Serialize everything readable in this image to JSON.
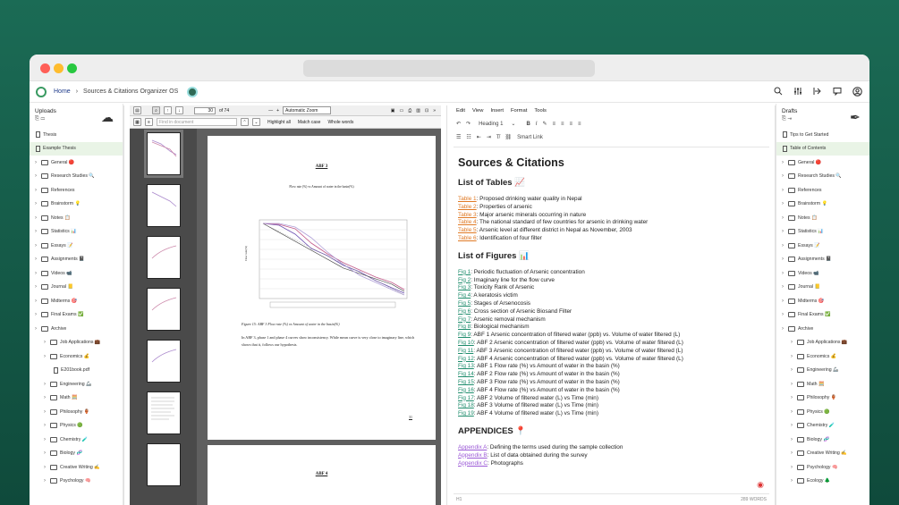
{
  "breadcrumb": {
    "home": "Home",
    "app": "Sources & Citations Organizer OS"
  },
  "icons": {
    "top": [
      "search-icon",
      "sliders-icon",
      "share-icon",
      "chat-icon",
      "user-icon"
    ]
  },
  "left": {
    "title": "Uploads",
    "items": [
      {
        "label": "Thesis",
        "type": "file",
        "indent": 0,
        "sel": false
      },
      {
        "label": "Example Thesis",
        "type": "file",
        "indent": 0,
        "sel": true
      },
      {
        "label": "General 🔴",
        "type": "folder",
        "indent": 0,
        "sel": false
      },
      {
        "label": "Research Studies 🔍",
        "type": "folder",
        "indent": 0,
        "sel": false
      },
      {
        "label": "References",
        "type": "folder",
        "indent": 0,
        "sel": false
      },
      {
        "label": "Brainstorm 💡",
        "type": "folder",
        "indent": 0,
        "sel": false
      },
      {
        "label": "Notes 📋",
        "type": "folder",
        "indent": 0,
        "sel": false
      },
      {
        "label": "Statistics 📊",
        "type": "folder",
        "indent": 0,
        "sel": false
      },
      {
        "label": "Essays 📝",
        "type": "folder",
        "indent": 0,
        "sel": false
      },
      {
        "label": "Assignments 📓",
        "type": "folder",
        "indent": 0,
        "sel": false
      },
      {
        "label": "Videos 📹",
        "type": "folder",
        "indent": 0,
        "sel": false
      },
      {
        "label": "Journal 📒",
        "type": "folder",
        "indent": 0,
        "sel": false
      },
      {
        "label": "Midterms 🎯",
        "type": "folder",
        "indent": 0,
        "sel": false
      },
      {
        "label": "Final Exams ✅",
        "type": "folder",
        "indent": 0,
        "sel": false
      },
      {
        "label": "Archive",
        "type": "folder",
        "indent": 0,
        "sel": false
      },
      {
        "label": "Job Applications 💼",
        "type": "folder",
        "indent": 1,
        "sel": false
      },
      {
        "label": "Economics 💰",
        "type": "folder",
        "indent": 1,
        "sel": false
      },
      {
        "label": "E201book.pdf",
        "type": "file",
        "indent": 2,
        "sel": false
      },
      {
        "label": "Engineering 🦾",
        "type": "folder",
        "indent": 1,
        "sel": false
      },
      {
        "label": "Math 🧮",
        "type": "folder",
        "indent": 1,
        "sel": false
      },
      {
        "label": "Philosophy 🏺",
        "type": "folder",
        "indent": 1,
        "sel": false
      },
      {
        "label": "Physics 🟢",
        "type": "folder",
        "indent": 1,
        "sel": false
      },
      {
        "label": "Chemistry 🧪",
        "type": "folder",
        "indent": 1,
        "sel": false
      },
      {
        "label": "Biology 🧬",
        "type": "folder",
        "indent": 1,
        "sel": false
      },
      {
        "label": "Creative Writing ✍️",
        "type": "folder",
        "indent": 1,
        "sel": false
      },
      {
        "label": "Psychology 🧠",
        "type": "folder",
        "indent": 1,
        "sel": false
      }
    ]
  },
  "right": {
    "title": "Drafts",
    "items": [
      {
        "label": "Tips to Get Started",
        "type": "file",
        "indent": 0,
        "sel": false
      },
      {
        "label": "Table of Contents",
        "type": "file",
        "indent": 0,
        "sel": true
      },
      {
        "label": "General 🔴",
        "type": "folder",
        "indent": 0,
        "sel": false
      },
      {
        "label": "Research Studies 🔍",
        "type": "folder",
        "indent": 0,
        "sel": false
      },
      {
        "label": "References",
        "type": "folder",
        "indent": 0,
        "sel": false
      },
      {
        "label": "Brainstorm 💡",
        "type": "folder",
        "indent": 0,
        "sel": false
      },
      {
        "label": "Notes 📋",
        "type": "folder",
        "indent": 0,
        "sel": false
      },
      {
        "label": "Statistics 📊",
        "type": "folder",
        "indent": 0,
        "sel": false
      },
      {
        "label": "Essays 📝",
        "type": "folder",
        "indent": 0,
        "sel": false
      },
      {
        "label": "Assignments 📓",
        "type": "folder",
        "indent": 0,
        "sel": false
      },
      {
        "label": "Videos 📹",
        "type": "folder",
        "indent": 0,
        "sel": false
      },
      {
        "label": "Journal 📒",
        "type": "folder",
        "indent": 0,
        "sel": false
      },
      {
        "label": "Midterms 🎯",
        "type": "folder",
        "indent": 0,
        "sel": false
      },
      {
        "label": "Final Exams ✅",
        "type": "folder",
        "indent": 0,
        "sel": false
      },
      {
        "label": "Archive",
        "type": "folder",
        "indent": 0,
        "sel": false
      },
      {
        "label": "Job Applications 💼",
        "type": "folder",
        "indent": 1,
        "sel": false
      },
      {
        "label": "Economics 💰",
        "type": "folder",
        "indent": 1,
        "sel": false
      },
      {
        "label": "Engineering 🦾",
        "type": "folder",
        "indent": 1,
        "sel": false
      },
      {
        "label": "Math 🧮",
        "type": "folder",
        "indent": 1,
        "sel": false
      },
      {
        "label": "Philosophy 🏺",
        "type": "folder",
        "indent": 1,
        "sel": false
      },
      {
        "label": "Physics 🟢",
        "type": "folder",
        "indent": 1,
        "sel": false
      },
      {
        "label": "Chemistry 🧪",
        "type": "folder",
        "indent": 1,
        "sel": false
      },
      {
        "label": "Biology 🧬",
        "type": "folder",
        "indent": 1,
        "sel": false
      },
      {
        "label": "Creative Writing ✍️",
        "type": "folder",
        "indent": 1,
        "sel": false
      },
      {
        "label": "Psychology 🧠",
        "type": "folder",
        "indent": 1,
        "sel": false
      },
      {
        "label": "Ecology 🌲",
        "type": "folder",
        "indent": 1,
        "sel": false
      }
    ]
  },
  "pdf": {
    "page_num": "30",
    "page_total": "of 74",
    "zoom": "Automatic Zoom",
    "find_placeholder": "Find in document",
    "highlight_all": "Highlight all",
    "match_case": "Match case",
    "whole_words": "Whole words",
    "page_heading": "ABF 3",
    "chart_title": "Flow rate (%) vs Amount of water in the basin(%)",
    "caption": "Figure 15: ABF 3 Flow rate (%) vs Amount of water in the basin(%)",
    "body": "In ABF 3, phase 1 and phase 4 curves show inconsistency. While mean curve is very close to imaginary line, which shows that it, follows our hypothesis.",
    "page_no": "31",
    "next_heading": "ABF 4"
  },
  "editor": {
    "menu": [
      "Edit",
      "View",
      "Insert",
      "Format",
      "Tools"
    ],
    "heading_select": "Heading 1",
    "smart_link": "Smart Link",
    "title": "Sources & Citations",
    "tables_h": "List of Tables 📈",
    "tables": [
      {
        "link": "Table 1",
        "text": ": Proposed drinking water quality in Nepal"
      },
      {
        "link": "Table 2",
        "text": ": Properties of arsenic"
      },
      {
        "link": "Table 3",
        "text": ": Major arsenic minerals occurring in nature"
      },
      {
        "link": "Table 4",
        "text": ": The national standard of few countries for arsenic in drinking water"
      },
      {
        "link": "Table 5",
        "text": ": Arsenic level at different district in Nepal as November, 2003"
      },
      {
        "link": "Table 6",
        "text": ": Identification of four filter"
      }
    ],
    "figs_h": "List of Figures 📊",
    "figs": [
      {
        "link": "Fig 1",
        "text": ": Periodic fluctuation of Arsenic concentration"
      },
      {
        "link": "Fig 2",
        "text": ": Imaginary line for the flow curve"
      },
      {
        "link": "Fig 3",
        "text": ": Toxicity Rank of Arsenic"
      },
      {
        "link": "Fig 4",
        "text": ": A keratosis victim"
      },
      {
        "link": "Fig 5",
        "text": ": Stages of Arsenocosis"
      },
      {
        "link": "Fig 6",
        "text": ": Cross section of Arsenic Biosand Filter"
      },
      {
        "link": "Fig 7",
        "text": ": Arsenic removal mechanism"
      },
      {
        "link": "Fig 8",
        "text": ": Biological mechanism"
      },
      {
        "link": "Fig 9",
        "text": ": ABF 1 Arsenic concentration of filtered water (ppb) vs. Volume of water filtered (L)"
      },
      {
        "link": "Fig 10",
        "text": ": ABF 2 Arsenic concentration of filtered water (ppb) vs. Volume of water filtered (L)"
      },
      {
        "link": "Fig 11",
        "text": ": ABF 3 Arsenic concentration of filtered water (ppb) vs. Volume of water filtered (L)"
      },
      {
        "link": "Fig 12",
        "text": ": ABF 4 Arsenic concentration of filtered water (ppb) vs. Volume of water filtered (L)"
      },
      {
        "link": "Fig 13",
        "text": ": ABF 1 Flow rate (%) vs Amount of water in the basin (%)"
      },
      {
        "link": "Fig 14",
        "text": ": ABF 2 Flow rate (%) vs Amount of water in the basin (%)"
      },
      {
        "link": "Fig 15",
        "text": ": ABF 3 Flow rate (%) vs Amount of water in the basin (%)"
      },
      {
        "link": "Fig 16",
        "text": ": ABF 4 Flow rate (%) vs Amount of water in the basin (%)"
      },
      {
        "link": "Fig 17",
        "text": ": ABF 2 Volume of filtered water (L) vs Time (min)"
      },
      {
        "link": "Fig 18",
        "text": ": ABF 3 Volume of filtered water (L) vs Time (min)"
      },
      {
        "link": "Fig 19",
        "text": ": ABF 4 Volume of filtered water (L) vs Time (min)"
      }
    ],
    "app_h": "APPENDICES 📍",
    "apps": [
      {
        "link": "Appendix A",
        "text": ": Defining the terms used during the sample collection"
      },
      {
        "link": "Appendix B",
        "text": ": List of data obtained during the survey"
      },
      {
        "link": "Appendix C",
        "text": ": Photographs"
      }
    ],
    "status_left": "H1",
    "word_count": "289 WORDS"
  }
}
